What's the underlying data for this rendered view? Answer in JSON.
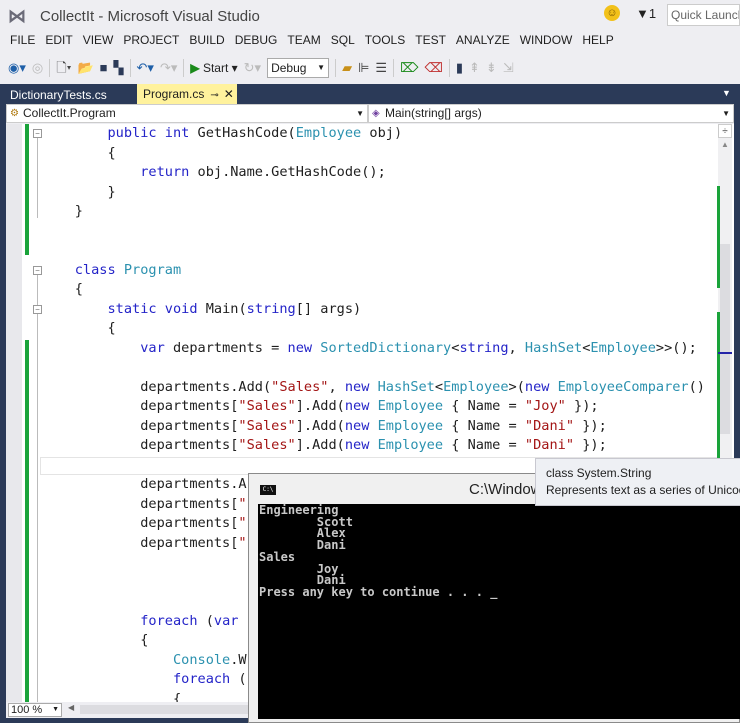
{
  "window": {
    "title": "CollectIt - Microsoft Visual Studio",
    "quick_launch_placeholder": "Quick Launch",
    "notification_count": "1"
  },
  "menu": [
    "FILE",
    "EDIT",
    "VIEW",
    "PROJECT",
    "BUILD",
    "DEBUG",
    "TEAM",
    "SQL",
    "TOOLS",
    "TEST",
    "ANALYZE",
    "WINDOW",
    "HELP"
  ],
  "toolbar": {
    "start_label": "Start",
    "configuration": "Debug"
  },
  "tabs": [
    {
      "label": "DictionaryTests.cs",
      "active": false
    },
    {
      "label": "Program.cs",
      "active": true
    }
  ],
  "navbar": {
    "type_selector": "CollectIt.Program",
    "member_selector": "Main(string[] args)"
  },
  "editor": {
    "zoom": "100 %",
    "colors": {
      "keyword": "#2424c8",
      "type": "#2b91af",
      "string": "#a31515",
      "change_bar": "#1aa33a"
    },
    "lines": [
      [
        [
          "        ",
          "pl"
        ],
        [
          "public",
          "kw"
        ],
        [
          " ",
          "pl"
        ],
        [
          "int",
          "kw"
        ],
        [
          " GetHashCode(",
          "pl"
        ],
        [
          "Employee",
          "ty"
        ],
        [
          " obj)",
          "pl"
        ]
      ],
      [
        [
          "        {",
          "pl"
        ]
      ],
      [
        [
          "            ",
          "pl"
        ],
        [
          "return",
          "kw"
        ],
        [
          " obj.Name.GetHashCode();",
          "pl"
        ]
      ],
      [
        [
          "        }",
          "pl"
        ]
      ],
      [
        [
          "    }",
          "pl"
        ]
      ],
      [],
      [],
      [
        [
          "    ",
          "pl"
        ],
        [
          "class",
          "kw"
        ],
        [
          " ",
          "pl"
        ],
        [
          "Program",
          "ty"
        ]
      ],
      [
        [
          "    {",
          "pl"
        ]
      ],
      [
        [
          "        ",
          "pl"
        ],
        [
          "static",
          "kw"
        ],
        [
          " ",
          "pl"
        ],
        [
          "void",
          "kw"
        ],
        [
          " Main(",
          "pl"
        ],
        [
          "string",
          "kw"
        ],
        [
          "[] args)",
          "pl"
        ]
      ],
      [
        [
          "        {",
          "pl"
        ]
      ],
      [
        [
          "            ",
          "pl"
        ],
        [
          "var",
          "kw"
        ],
        [
          " departments = ",
          "pl"
        ],
        [
          "new",
          "kw"
        ],
        [
          " ",
          "pl"
        ],
        [
          "SortedDictionary",
          "ty"
        ],
        [
          "<",
          "pl"
        ],
        [
          "string",
          "kw"
        ],
        [
          ", ",
          "pl"
        ],
        [
          "HashSet",
          "ty"
        ],
        [
          "<",
          "pl"
        ],
        [
          "Employee",
          "ty"
        ],
        [
          ">>();",
          "pl"
        ]
      ],
      [],
      [
        [
          "            departments.Add(",
          "pl"
        ],
        [
          "\"Sales\"",
          "st"
        ],
        [
          ", ",
          "pl"
        ],
        [
          "new",
          "kw"
        ],
        [
          " ",
          "pl"
        ],
        [
          "HashSet",
          "ty"
        ],
        [
          "<",
          "pl"
        ],
        [
          "Employee",
          "ty"
        ],
        [
          ">(",
          "pl"
        ],
        [
          "new",
          "kw"
        ],
        [
          " ",
          "pl"
        ],
        [
          "EmployeeComparer",
          "ty"
        ],
        [
          "()",
          "pl"
        ]
      ],
      [
        [
          "            departments[",
          "pl"
        ],
        [
          "\"Sales\"",
          "st"
        ],
        [
          "].Add(",
          "pl"
        ],
        [
          "new",
          "kw"
        ],
        [
          " ",
          "pl"
        ],
        [
          "Employee",
          "ty"
        ],
        [
          " { Name = ",
          "pl"
        ],
        [
          "\"Joy\"",
          "st"
        ],
        [
          " });",
          "pl"
        ]
      ],
      [
        [
          "            departments[",
          "pl"
        ],
        [
          "\"Sales\"",
          "st"
        ],
        [
          "].Add(",
          "pl"
        ],
        [
          "new",
          "kw"
        ],
        [
          " ",
          "pl"
        ],
        [
          "Employee",
          "ty"
        ],
        [
          " { Name = ",
          "pl"
        ],
        [
          "\"Dani\"",
          "st"
        ],
        [
          " });",
          "pl"
        ]
      ],
      [
        [
          "            departments[",
          "pl"
        ],
        [
          "\"Sales\"",
          "st"
        ],
        [
          "].Add(",
          "pl"
        ],
        [
          "new",
          "kw"
        ],
        [
          " ",
          "pl"
        ],
        [
          "Employee",
          "ty"
        ],
        [
          " { Name = ",
          "pl"
        ],
        [
          "\"Dani\"",
          "st"
        ],
        [
          " });",
          "pl"
        ]
      ],
      [],
      [
        [
          "            departments.A",
          "pl"
        ]
      ],
      [
        [
          "            departments[",
          "pl"
        ],
        [
          "\"",
          "st"
        ]
      ],
      [
        [
          "            departments[",
          "pl"
        ],
        [
          "\"",
          "st"
        ]
      ],
      [
        [
          "            departments[",
          "pl"
        ],
        [
          "\"",
          "st"
        ]
      ],
      [],
      [],
      [],
      [
        [
          "            ",
          "pl"
        ],
        [
          "foreach",
          "kw"
        ],
        [
          " (",
          "pl"
        ],
        [
          "var",
          "kw"
        ]
      ],
      [
        [
          "            {",
          "pl"
        ]
      ],
      [
        [
          "                ",
          "pl"
        ],
        [
          "Console",
          "ty"
        ],
        [
          ".W",
          "pl"
        ]
      ],
      [
        [
          "                ",
          "pl"
        ],
        [
          "foreach",
          "kw"
        ],
        [
          " (",
          "pl"
        ]
      ],
      [
        [
          "                {",
          "pl"
        ]
      ]
    ]
  },
  "tooltip": {
    "signature": "class System.String",
    "description": "Represents text as a series of Unicode ch"
  },
  "console": {
    "title": "C:\\Windows",
    "output": "Engineering\n        Scott\n        Alex\n        Dani\nSales\n        Joy\n        Dani\nPress any key to continue . . . _"
  }
}
